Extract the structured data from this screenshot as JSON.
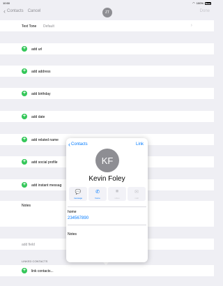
{
  "status": {
    "time": "10:50",
    "battery": "100%"
  },
  "nav": {
    "back_label": "Contacts",
    "cancel_label": "Cancel",
    "avatar_initials": "ZT",
    "done_label": "Done"
  },
  "text_tone": {
    "label": "Text Tone",
    "value": "Default"
  },
  "rows": {
    "add_url": "add url",
    "add_address": "add address",
    "add_birthday": "add birthday",
    "add_date": "add date",
    "add_related_name": "add related name",
    "add_social_profile": "add social profile",
    "add_instant_message": "add instant messag"
  },
  "notes_label": "Notes",
  "add_field": "add field",
  "linked_header": "LINKED CONTACTS",
  "link_contacts": "link contacts...",
  "popover": {
    "back_label": "Contacts",
    "link_label": "Link",
    "initials": "KF",
    "name": "Kevin Foley",
    "actions": [
      {
        "icon": "message-icon",
        "label": "message",
        "enabled": true
      },
      {
        "icon": "phone-icon",
        "label": "home",
        "enabled": true
      },
      {
        "icon": "video-icon",
        "label": "video",
        "enabled": false
      },
      {
        "icon": "mail-icon",
        "label": "mail",
        "enabled": false
      }
    ],
    "phone_label": "home",
    "phone_value": "234567890",
    "notes_label": "Notes"
  }
}
